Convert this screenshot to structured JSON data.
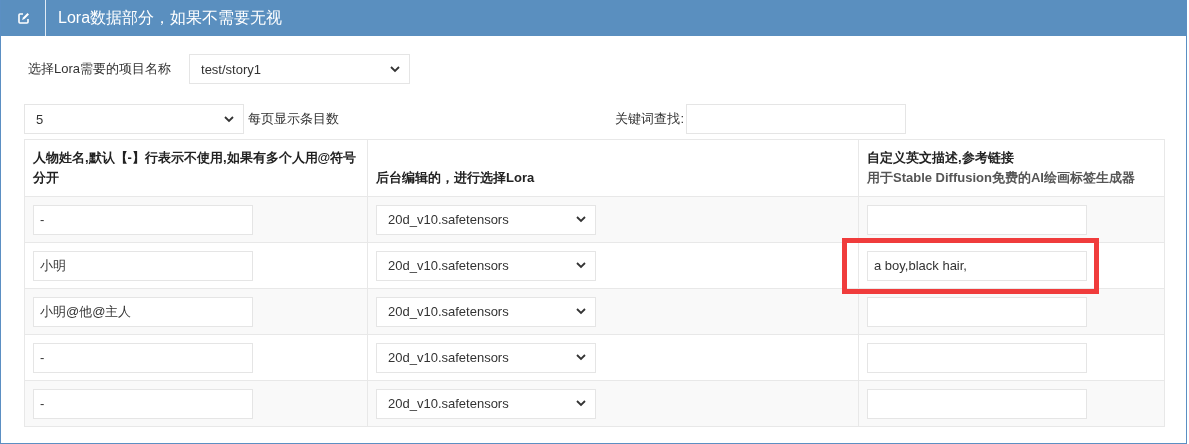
{
  "panel": {
    "title": "Lora数据部分，如果不需要无视"
  },
  "project": {
    "label": "选择Lora需要的项目名称",
    "value": "test/story1"
  },
  "page_size": {
    "value": "5",
    "label": "每页显示条目数"
  },
  "search": {
    "label": "关键词查找:"
  },
  "table": {
    "columns": [
      {
        "text": "人物姓名,默认【-】行表示不使用,如果有多个人用@符号分开"
      },
      {
        "text": "后台编辑的，进行选择Lora"
      },
      {
        "text": "自定义英文描述,参考链接",
        "link": "用于Stable Diffusion免费的AI绘画标签生成器"
      }
    ],
    "rows": [
      {
        "name": "-",
        "lora": "20d_v10.safetensors",
        "description": "",
        "highlighted": false
      },
      {
        "name": "小明",
        "lora": "20d_v10.safetensors",
        "description": "a boy,black hair,",
        "highlighted": true
      },
      {
        "name": "小明@他@主人",
        "lora": "20d_v10.safetensors",
        "description": "",
        "highlighted": false
      },
      {
        "name": "-",
        "lora": "20d_v10.safetensors",
        "description": "",
        "highlighted": false
      },
      {
        "name": "-",
        "lora": "20d_v10.safetensors",
        "description": "",
        "highlighted": false
      }
    ]
  }
}
